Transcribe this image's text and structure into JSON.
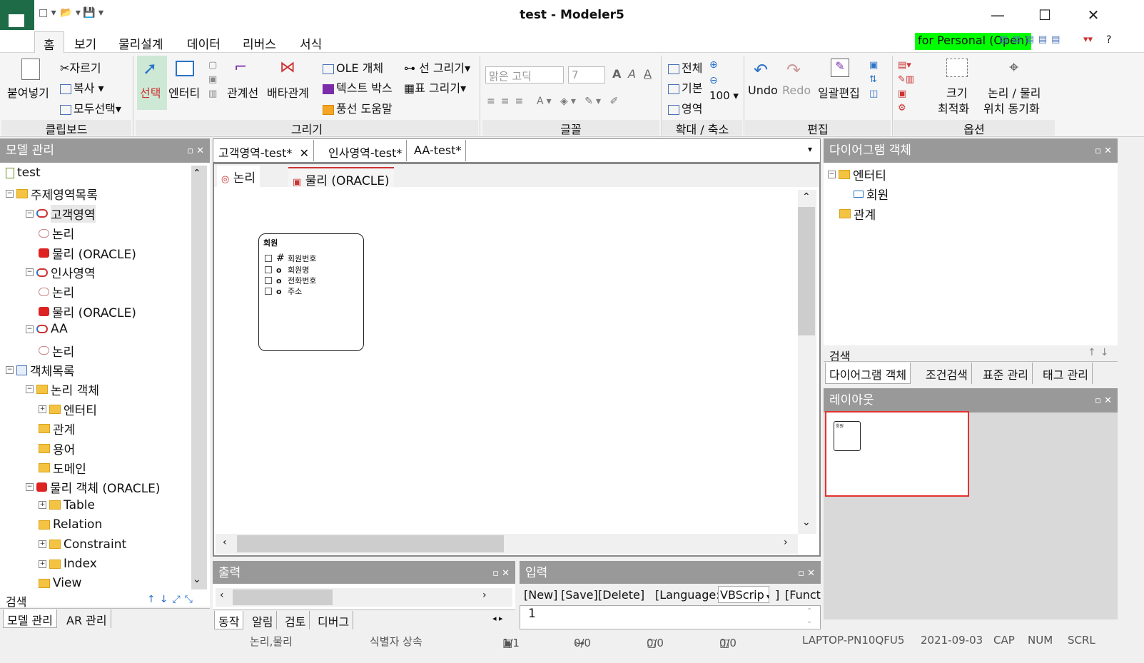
{
  "window": {
    "title": "test - Modeler5",
    "minimize": "—",
    "maximize": "☐",
    "close": "✕"
  },
  "qat": {
    "new": "□ ▾",
    "open": "📂 ▾",
    "save": "💾 ▾",
    "more": "▾"
  },
  "menu": {
    "tabs": [
      "홈",
      "보기",
      "물리설계",
      "데이터",
      "리버스",
      "서식"
    ],
    "active_index": 0,
    "license_badge": "for Personal (Open)",
    "help": "?"
  },
  "ribbon": {
    "clipboard": {
      "paste": "붙여넣기",
      "cut": "자르기",
      "copy": "복사",
      "select_all": "모두선택",
      "group": "클립보드"
    },
    "draw": {
      "select": "선택",
      "entity": "엔터티",
      "relation_line": "관계선",
      "exclusive": "배타관계",
      "ole": "OLE 개체",
      "text_box": "텍스트 박스",
      "balloon": "풍선 도움말",
      "line_draw": "선 그리기",
      "table_draw": "표 그리기",
      "group": "그리기"
    },
    "font": {
      "font_name": "맑은 고딕",
      "font_size": "7",
      "bold": "A",
      "italic": "A",
      "under": "A",
      "group": "글꼴"
    },
    "zoom": {
      "all": "전체",
      "basic": "기본",
      "area": "영역",
      "level": "100",
      "group": "확대 / 축소"
    },
    "edit": {
      "undo": "Undo",
      "redo": "Redo",
      "bulk": "일괄편집",
      "group": "편집"
    },
    "options": {
      "fit_line1": "크기",
      "fit_line2": "최적화",
      "sync_line1": "논리 / 물리",
      "sync_line2": "위치 동기화",
      "group": "옵션"
    }
  },
  "left_panel": {
    "title": "모델 관리",
    "tree": [
      {
        "label": "test",
        "level": 0,
        "icon": "doc-icon"
      },
      {
        "label": "주제영역목록",
        "level": 0,
        "icon": "folder-icon"
      },
      {
        "label": "고객영역",
        "level": 1,
        "icon": "subject-icon"
      },
      {
        "label": "논리",
        "level": 2,
        "icon": "logical-icon"
      },
      {
        "label": "물리 (ORACLE)",
        "level": 2,
        "icon": "physical-icon"
      },
      {
        "label": "인사영역",
        "level": 1,
        "icon": "subject-icon"
      },
      {
        "label": "논리",
        "level": 2,
        "icon": "logical-icon"
      },
      {
        "label": "물리 (ORACLE)",
        "level": 2,
        "icon": "physical-icon"
      },
      {
        "label": "AA",
        "level": 1,
        "icon": "subject-icon"
      },
      {
        "label": "논리",
        "level": 2,
        "icon": "logical-icon"
      },
      {
        "label": "객체목록",
        "level": 0,
        "icon": "object-list-icon"
      },
      {
        "label": "논리 객체",
        "level": 1,
        "icon": "folder-icon"
      },
      {
        "label": "엔터티",
        "level": 2,
        "icon": "folder-icon"
      },
      {
        "label": "관계",
        "level": 2,
        "icon": "folder-icon"
      },
      {
        "label": "용어",
        "level": 2,
        "icon": "folder-icon"
      },
      {
        "label": "도메인",
        "level": 2,
        "icon": "folder-icon"
      },
      {
        "label": "물리 객체 (ORACLE)",
        "level": 1,
        "icon": "oracle-icon"
      },
      {
        "label": "Table",
        "level": 2,
        "icon": "folder-icon"
      },
      {
        "label": "Relation",
        "level": 2,
        "icon": "folder-icon"
      },
      {
        "label": "Constraint",
        "level": 2,
        "icon": "folder-icon"
      },
      {
        "label": "Index",
        "level": 2,
        "icon": "folder-icon"
      },
      {
        "label": "View",
        "level": 2,
        "icon": "folder-icon"
      }
    ],
    "search_label": "검색",
    "bottom_tabs": [
      "모델 관리",
      "AR 관리"
    ]
  },
  "doc_tabs": [
    "고객영역-test*",
    "인사영역-test*",
    "AA-test*"
  ],
  "view_tabs": [
    "논리",
    "물리 (ORACLE)"
  ],
  "entity": {
    "name": "회원",
    "attributes": [
      {
        "mark": "#",
        "name": "회원번호"
      },
      {
        "mark": "o",
        "name": "회원명"
      },
      {
        "mark": "o",
        "name": "전화번호"
      },
      {
        "mark": "o",
        "name": "주소"
      }
    ]
  },
  "output_panel": {
    "title": "출력",
    "tabs": [
      "동작",
      "알림",
      "검토",
      "디버그"
    ]
  },
  "input_panel": {
    "title": "입력",
    "new": "[New]",
    "save": "[Save]",
    "delete": "[Delete]",
    "language": "[Language:",
    "lang_value": "VBScrip",
    "close_bracket": "]",
    "function": "[Functi",
    "line_no": "1"
  },
  "right_panel": {
    "title": "다이어그램 객체",
    "tree": [
      {
        "label": "엔터티",
        "level": 0
      },
      {
        "label": "회원",
        "level": 1
      },
      {
        "label": "관계",
        "level": 0
      }
    ],
    "search_label": "검색",
    "tabs": [
      "다이어그램 객체",
      "조건검색",
      "표준 관리",
      "태그 관리"
    ]
  },
  "layout_panel": {
    "title": "레이아웃",
    "mini_label": "회원"
  },
  "status": {
    "mode": "논리,물리",
    "identifier": "식별자 상속",
    "count1": "1/",
    "count1b": "1",
    "count2": "0/",
    "count2b": "0",
    "count3": "0/",
    "count3b": "0",
    "count4": "0/",
    "count4b": "0",
    "host": "LAPTOP-PN10QFU5",
    "date": "2021-09-03",
    "cap": "CAP",
    "num": "NUM",
    "scrl": "SCRL"
  }
}
